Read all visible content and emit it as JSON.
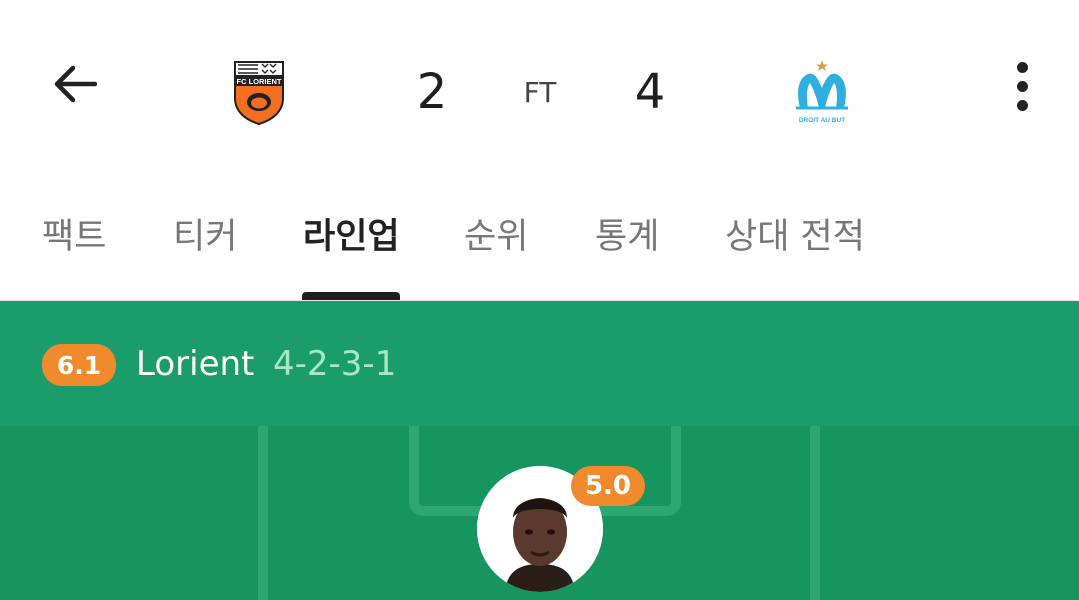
{
  "header": {
    "back_icon": "arrow-left-icon",
    "home_team_logo": "fc-lorient-crest",
    "home_logo_text": "FC LORIENT",
    "home_score": "2",
    "status": "FT",
    "away_score": "4",
    "away_team_logo": "olympique-de-marseille-crest",
    "away_logo_text": "DROIT AU BUT",
    "more_icon": "more-vertical-icon"
  },
  "tabs": [
    {
      "label": "팩트",
      "active": false
    },
    {
      "label": "티커",
      "active": false
    },
    {
      "label": "라인업",
      "active": true
    },
    {
      "label": "순위",
      "active": false
    },
    {
      "label": "통계",
      "active": false
    },
    {
      "label": "상대 전적",
      "active": false
    }
  ],
  "lineup": {
    "team_rating": "6.1",
    "team_name": "Lorient",
    "formation": "4-2-3-1",
    "players": [
      {
        "rating": "5.0",
        "avatar": "player-photo"
      }
    ]
  },
  "colors": {
    "lineup_header_bg": "#1b9d6b",
    "pitch_bg": "#16955f",
    "rating_badge": "#f08a2c",
    "formation_text": "#a9e6c6",
    "lorient_orange": "#f26f21",
    "marseille_blue": "#2fafe0"
  }
}
